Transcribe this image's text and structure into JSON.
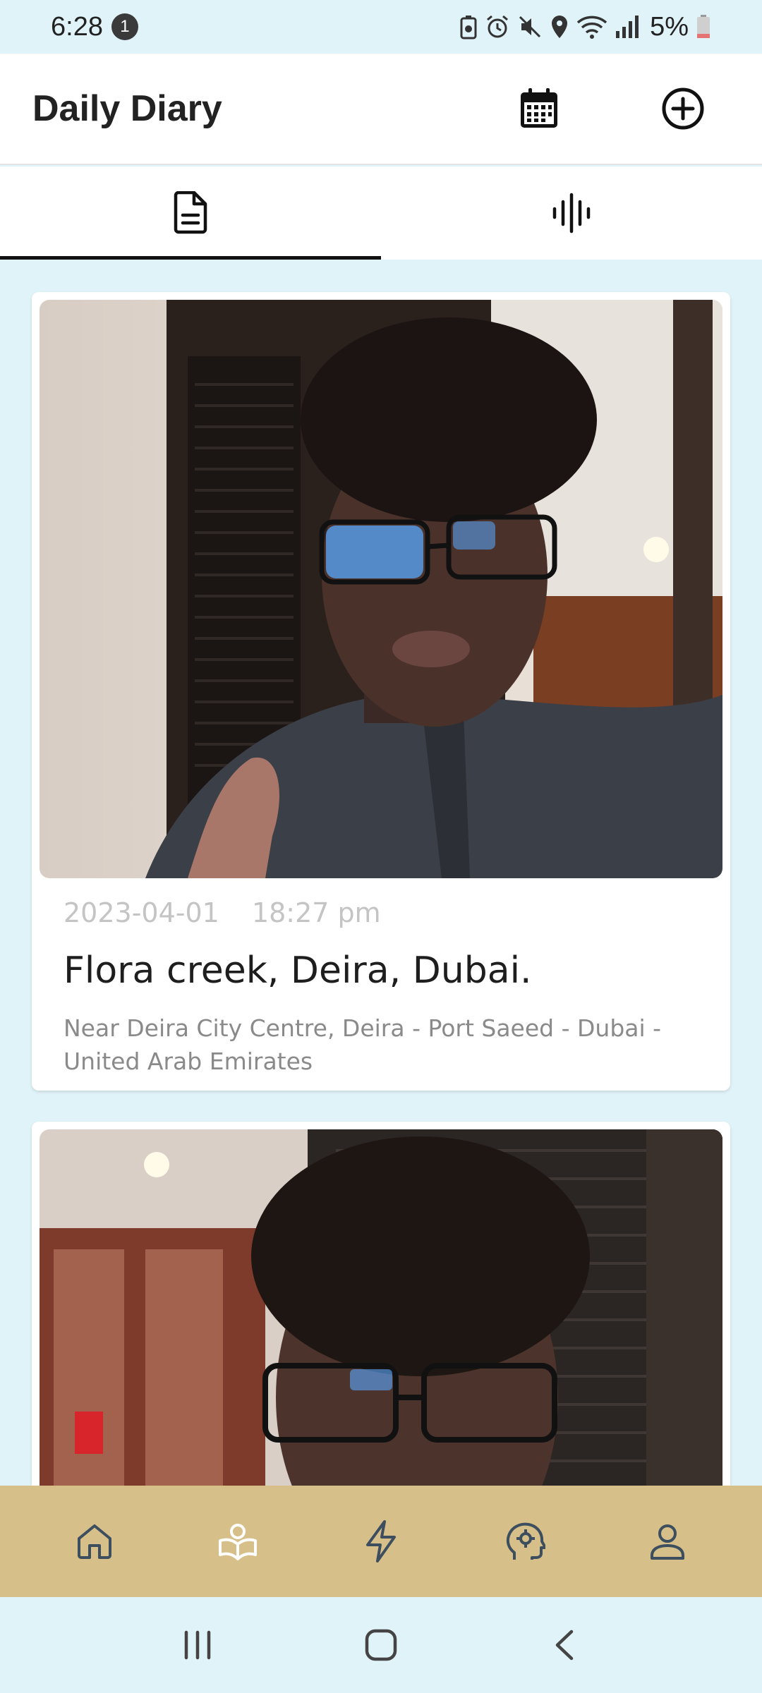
{
  "status_bar": {
    "time": "6:28",
    "notification_count": "1",
    "battery": "5%"
  },
  "app_bar": {
    "title": "Daily Diary",
    "icons": [
      "calendar-icon",
      "add-circle-icon"
    ]
  },
  "tabs": [
    {
      "name": "document-icon",
      "active": true
    },
    {
      "name": "audio-wave-icon",
      "active": false
    }
  ],
  "entries": [
    {
      "date": "2023-04-01",
      "time": "18:27 pm",
      "title": "Flora creek, Deira, Dubai.",
      "address": "Near Deira City Centre, Deira - Port Saeed - Dubai - United Arab Emirates"
    }
  ],
  "bottom_nav": [
    "home-icon",
    "journal-icon",
    "lightning-icon",
    "mind-icon",
    "profile-icon"
  ],
  "colors": {
    "background": "#e0f3f8",
    "bottom_nav": "#d6bf89",
    "accent": "#111111"
  }
}
